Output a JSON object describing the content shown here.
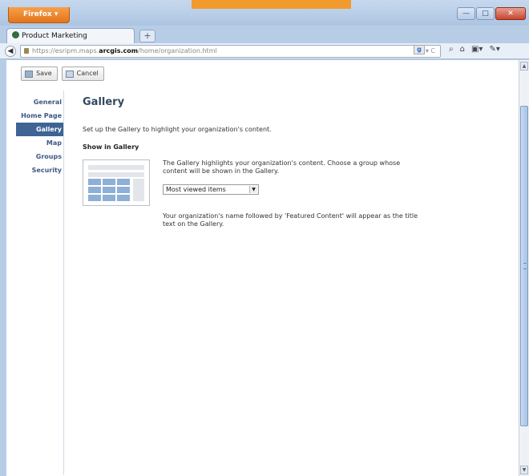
{
  "browser": {
    "menu_label": "Firefox ▾",
    "window_controls": {
      "minimize": "—",
      "maximize": "□",
      "close": "✕"
    },
    "tab": {
      "title": "Product Marketing",
      "new_tab": "+"
    },
    "url": {
      "prefix": "https://esripm.maps.",
      "host": "arcgis.com",
      "path": "/home/organization.html"
    },
    "nav_icons": [
      "☆ ▾ C",
      "⌕",
      "⌂",
      "▣▾",
      "✎▾"
    ],
    "addon_label": "g"
  },
  "toolbar": {
    "save_label": "Save",
    "cancel_label": "Cancel"
  },
  "sidebar": {
    "items": [
      {
        "label": "General"
      },
      {
        "label": "Home Page"
      },
      {
        "label": "Gallery"
      },
      {
        "label": "Map"
      },
      {
        "label": "Groups"
      },
      {
        "label": "Security"
      }
    ],
    "active": "Gallery"
  },
  "main": {
    "title": "Gallery",
    "intro": "Set up the Gallery to highlight your organization's content.",
    "section_label": "Show in Gallery",
    "description": "The Gallery highlights your organization's content. Choose a group whose content will be shown in the Gallery.",
    "select_value": "Most viewed items",
    "note": "Your organization's name followed by 'Featured Content' will appear as the title text on the Gallery."
  }
}
